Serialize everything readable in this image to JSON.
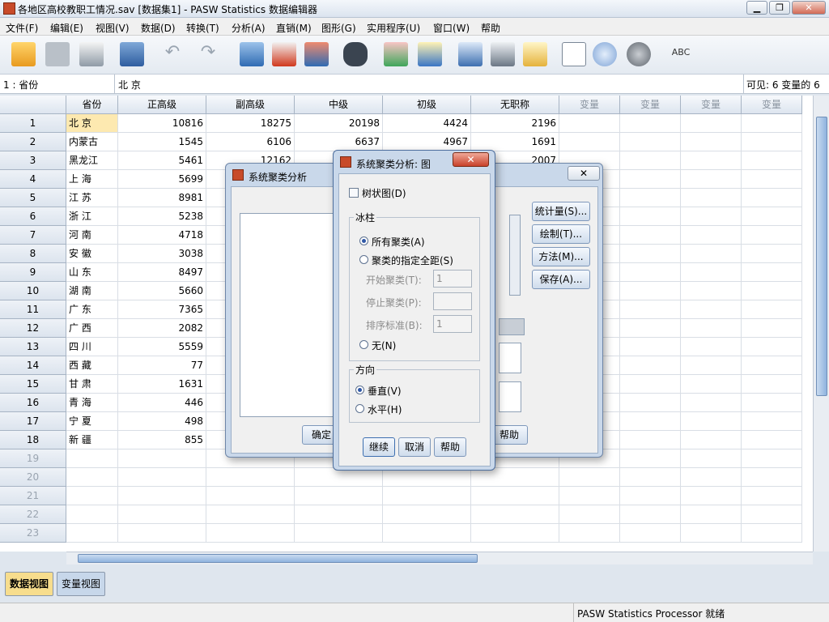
{
  "window": {
    "title": "各地区高校教职工情况.sav [数据集1] - PASW Statistics 数据编辑器"
  },
  "menu": [
    "文件(F)",
    "编辑(E)",
    "视图(V)",
    "数据(D)",
    "转换(T)",
    "分析(A)",
    "直销(M)",
    "图形(G)",
    "实用程序(U)",
    "窗口(W)",
    "帮助"
  ],
  "cellbar": {
    "ref": "1 : 省份",
    "value": "北 京",
    "visible": "可见: 6 变量的 6"
  },
  "columns": [
    "省份",
    "正高级",
    "副高级",
    "中级",
    "初级",
    "无职称",
    "变量",
    "变量",
    "变量",
    "变量"
  ],
  "rows": [
    [
      "北 京",
      "10816",
      "18275",
      "20198",
      "4424",
      "2196"
    ],
    [
      "内蒙古",
      "1545",
      "6106",
      "6637",
      "4967",
      "1691"
    ],
    [
      "黑龙江",
      "5461",
      "12162",
      "",
      "",
      "2007"
    ],
    [
      "上 海",
      "5699",
      "",
      "",
      "",
      ""
    ],
    [
      "江 苏",
      "8981",
      "",
      "",
      "",
      ""
    ],
    [
      "浙 江",
      "5238",
      "",
      "",
      "",
      ""
    ],
    [
      "河 南",
      "4718",
      "",
      "",
      "",
      ""
    ],
    [
      "安 徽",
      "3038",
      "",
      "",
      "",
      ""
    ],
    [
      "山 东",
      "8497",
      "",
      "",
      "",
      ""
    ],
    [
      "湖 南",
      "5660",
      "",
      "",
      "",
      ""
    ],
    [
      "广 东",
      "7365",
      "",
      "",
      "",
      ""
    ],
    [
      "广 西",
      "2082",
      "",
      "",
      "",
      ""
    ],
    [
      "四 川",
      "5559",
      "",
      "",
      "",
      ""
    ],
    [
      "西 藏",
      "77",
      "",
      "",
      "",
      ""
    ],
    [
      "甘 肃",
      "1631",
      "",
      "",
      "",
      ""
    ],
    [
      "青 海",
      "446",
      "",
      "",
      "",
      ""
    ],
    [
      "宁 夏",
      "498",
      "",
      "",
      "",
      ""
    ],
    [
      "新 疆",
      "855",
      "",
      "",
      "",
      ""
    ]
  ],
  "row_numbers": [
    "1",
    "2",
    "3",
    "4",
    "5",
    "6",
    "7",
    "8",
    "9",
    "10",
    "11",
    "12",
    "13",
    "14",
    "15",
    "16",
    "17",
    "18",
    "19",
    "20",
    "21",
    "22",
    "23"
  ],
  "tabs": {
    "data_view": "数据视图",
    "variable_view": "变量视图"
  },
  "status": {
    "processor": "PASW Statistics Processor 就绪"
  },
  "cluster_dialog": {
    "title": "系统聚类分析",
    "buttons": {
      "statistics": "统计量(S)...",
      "plots": "绘制(T)...",
      "method": "方法(M)...",
      "save": "保存(A)...",
      "ok": "确定",
      "help": "帮助"
    }
  },
  "plots_dialog": {
    "title": "系统聚类分析: 图",
    "dendrogram": "树状图(D)",
    "icicle": {
      "legend": "冰柱",
      "all_clusters": "所有聚类(A)",
      "specified_range": "聚类的指定全距(S)",
      "start_label": "开始聚类(T):",
      "start_value": "1",
      "stop_label": "停止聚类(P):",
      "stop_value": "",
      "by_label": "排序标准(B):",
      "by_value": "1",
      "none": "无(N)"
    },
    "orientation": {
      "legend": "方向",
      "vertical": "垂直(V)",
      "horizontal": "水平(H)"
    },
    "buttons": {
      "continue": "继续",
      "cancel": "取消",
      "help": "帮助"
    }
  }
}
